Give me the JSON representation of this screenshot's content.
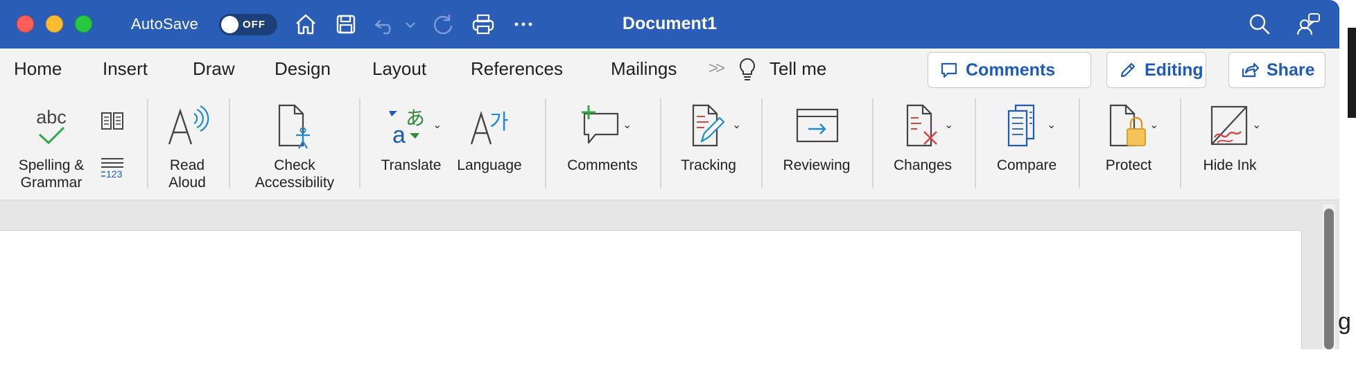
{
  "titlebar": {
    "autosave_label": "AutoSave",
    "autosave_state": "OFF",
    "title": "Document1",
    "icons": [
      "home-icon",
      "save-icon",
      "undo-icon",
      "redo-icon",
      "print-icon",
      "more-icon",
      "search-icon",
      "share-people-icon"
    ],
    "colors": {
      "bar": "#2a5db5",
      "text": "#ffffff"
    }
  },
  "tabs": {
    "items": [
      "Home",
      "Insert",
      "Draw",
      "Design",
      "Layout",
      "References",
      "Mailings"
    ],
    "tell_me": "Tell me",
    "comments_button": "Comments",
    "editing_button": "Editing",
    "share_button": "Share",
    "accent": "#1e5bb8"
  },
  "ribbon": {
    "spelling": {
      "line1": "Spelling &",
      "line2": "Grammar",
      "icon_text": "abc"
    },
    "word_count_icon_text": "123",
    "read_aloud": {
      "line1": "Read",
      "line2": "Aloud"
    },
    "check_accessibility": {
      "line1": "Check",
      "line2": "Accessibility"
    },
    "translate": "Translate",
    "language": "Language",
    "comments": "Comments",
    "tracking": "Tracking",
    "reviewing": "Reviewing",
    "changes": "Changes",
    "compare": "Compare",
    "protect": "Protect",
    "hide_ink": "Hide Ink"
  },
  "background_letter": "g"
}
